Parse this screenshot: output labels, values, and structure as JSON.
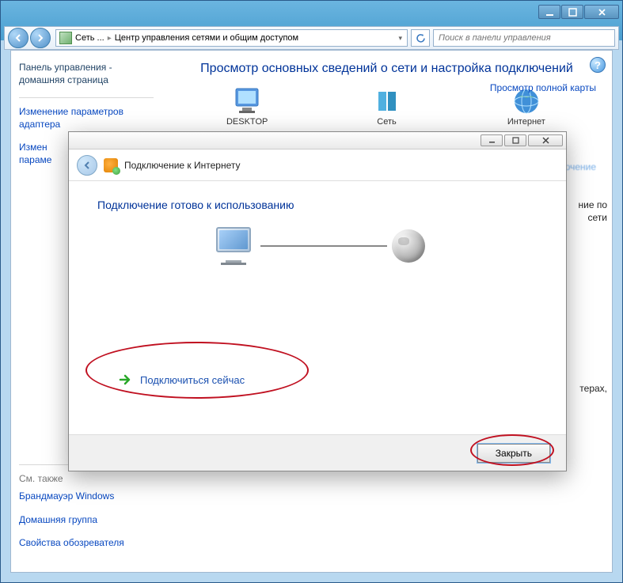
{
  "outer_window": {
    "breadcrumb": {
      "level1": "Сеть ...",
      "level2": "Центр управления сетями и общим доступом"
    },
    "search_placeholder": "Поиск в панели управления"
  },
  "sidebar": {
    "home": "Панель управления - домашняя страница",
    "adapter": "Изменение параметров адаптера",
    "sharing_prefix": "Измен",
    "sharing_line2": "параме",
    "bottom": {
      "heading": "См. также",
      "firewall": "Брандмауэр Windows",
      "homegroup": "Домашняя группа",
      "internet_options": "Свойства обозревателя"
    }
  },
  "main": {
    "heading": "Просмотр основных сведений о сети и настройка подключений",
    "map_link": "Просмотр полной карты",
    "nodes": {
      "desktop": "DESKTOP",
      "network": "Сеть",
      "internet": "Интернет"
    },
    "task_link_blur": "Под_______ или ____ючение",
    "frag1": "ние по",
    "frag2": "сети",
    "frag3": "терах,"
  },
  "dialog": {
    "title": "Подключение к Интернету",
    "heading": "Подключение готово к использованию",
    "connect_now": "Подключиться сейчас",
    "close_button": "Закрыть"
  }
}
